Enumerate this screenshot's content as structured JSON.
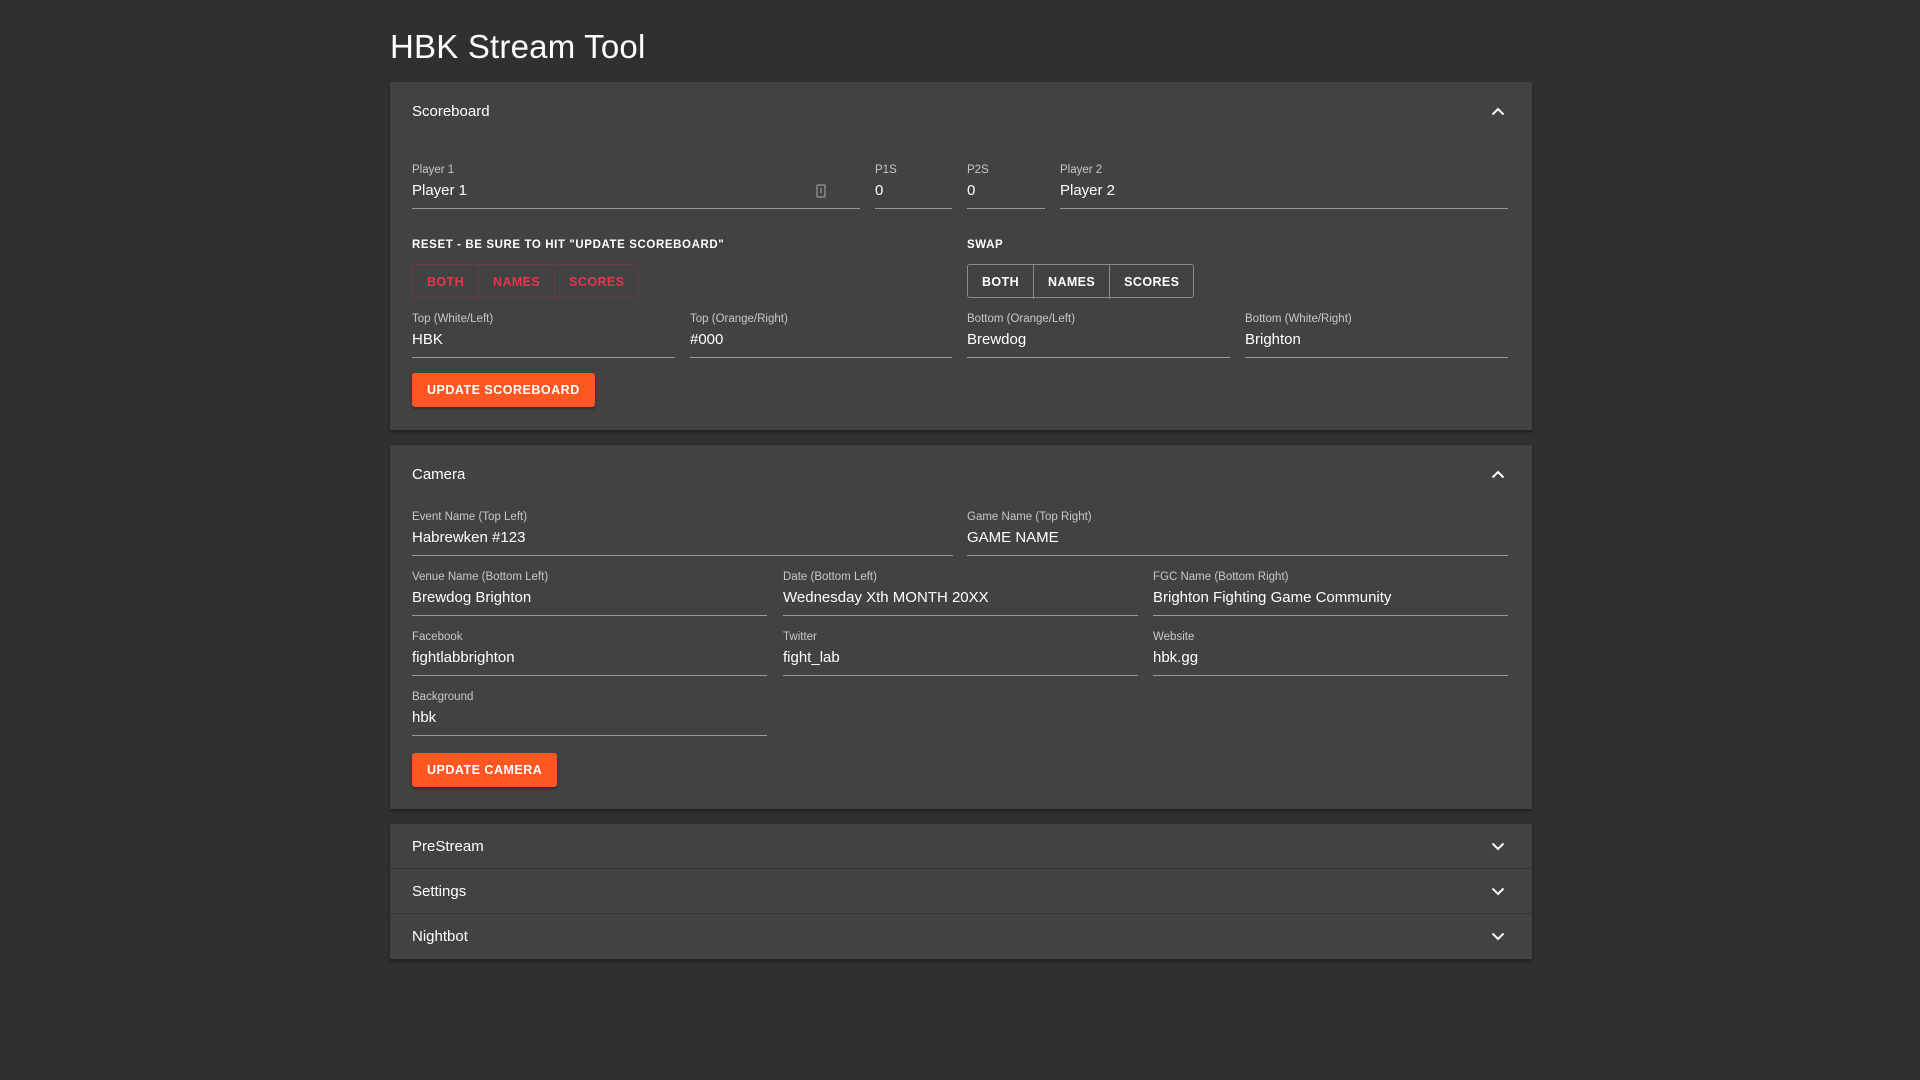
{
  "app": {
    "title": "HBK Stream Tool"
  },
  "colors": {
    "background": "#303030",
    "panel": "#424242",
    "accent": "#ff5722",
    "reset_red": "#e8344f"
  },
  "scoreboard": {
    "title": "Scoreboard",
    "expand_icon": "chevron-up-icon",
    "player1": {
      "label": "Player 1",
      "value": "Player 1"
    },
    "p1s": {
      "label": "P1S",
      "value": "0"
    },
    "p2s": {
      "label": "P2S",
      "value": "0"
    },
    "player2": {
      "label": "Player 2",
      "value": "Player 2"
    },
    "reset_label": "RESET - BE SURE TO HIT \"UPDATE SCOREBOARD\"",
    "reset_buttons": {
      "both": "BOTH",
      "names": "NAMES",
      "scores": "SCORES"
    },
    "swap_label": "SWAP",
    "swap_buttons": {
      "both": "BOTH",
      "names": "NAMES",
      "scores": "SCORES"
    },
    "top_left": {
      "label": "Top (White/Left)",
      "value": "HBK"
    },
    "top_right": {
      "label": "Top (Orange/Right)",
      "value": "#000"
    },
    "bottom_left": {
      "label": "Bottom (Orange/Left)",
      "value": "Brewdog"
    },
    "bottom_right": {
      "label": "Bottom (White/Right)",
      "value": "Brighton"
    },
    "update_button": "UPDATE SCOREBOARD"
  },
  "camera": {
    "title": "Camera",
    "expand_icon": "chevron-up-icon",
    "event_name": {
      "label": "Event Name (Top Left)",
      "value": "Habrewken #123"
    },
    "game_name": {
      "label": "Game Name (Top Right)",
      "value": "GAME NAME"
    },
    "venue_name": {
      "label": "Venue Name (Bottom Left)",
      "value": "Brewdog Brighton"
    },
    "date": {
      "label": "Date (Bottom Left)",
      "value": "Wednesday Xth MONTH 20XX"
    },
    "fgc_name": {
      "label": "FGC Name (Bottom Right)",
      "value": "Brighton Fighting Game Community"
    },
    "facebook": {
      "label": "Facebook",
      "value": "fightlabbrighton"
    },
    "twitter": {
      "label": "Twitter",
      "value": "fight_lab"
    },
    "website": {
      "label": "Website",
      "value": "hbk.gg"
    },
    "background": {
      "label": "Background",
      "value": "hbk"
    },
    "update_button": "UPDATE CAMERA"
  },
  "collapsed_panels": [
    {
      "title": "PreStream",
      "icon": "chevron-down-icon"
    },
    {
      "title": "Settings",
      "icon": "chevron-down-icon"
    },
    {
      "title": "Nightbot",
      "icon": "chevron-down-icon"
    }
  ]
}
